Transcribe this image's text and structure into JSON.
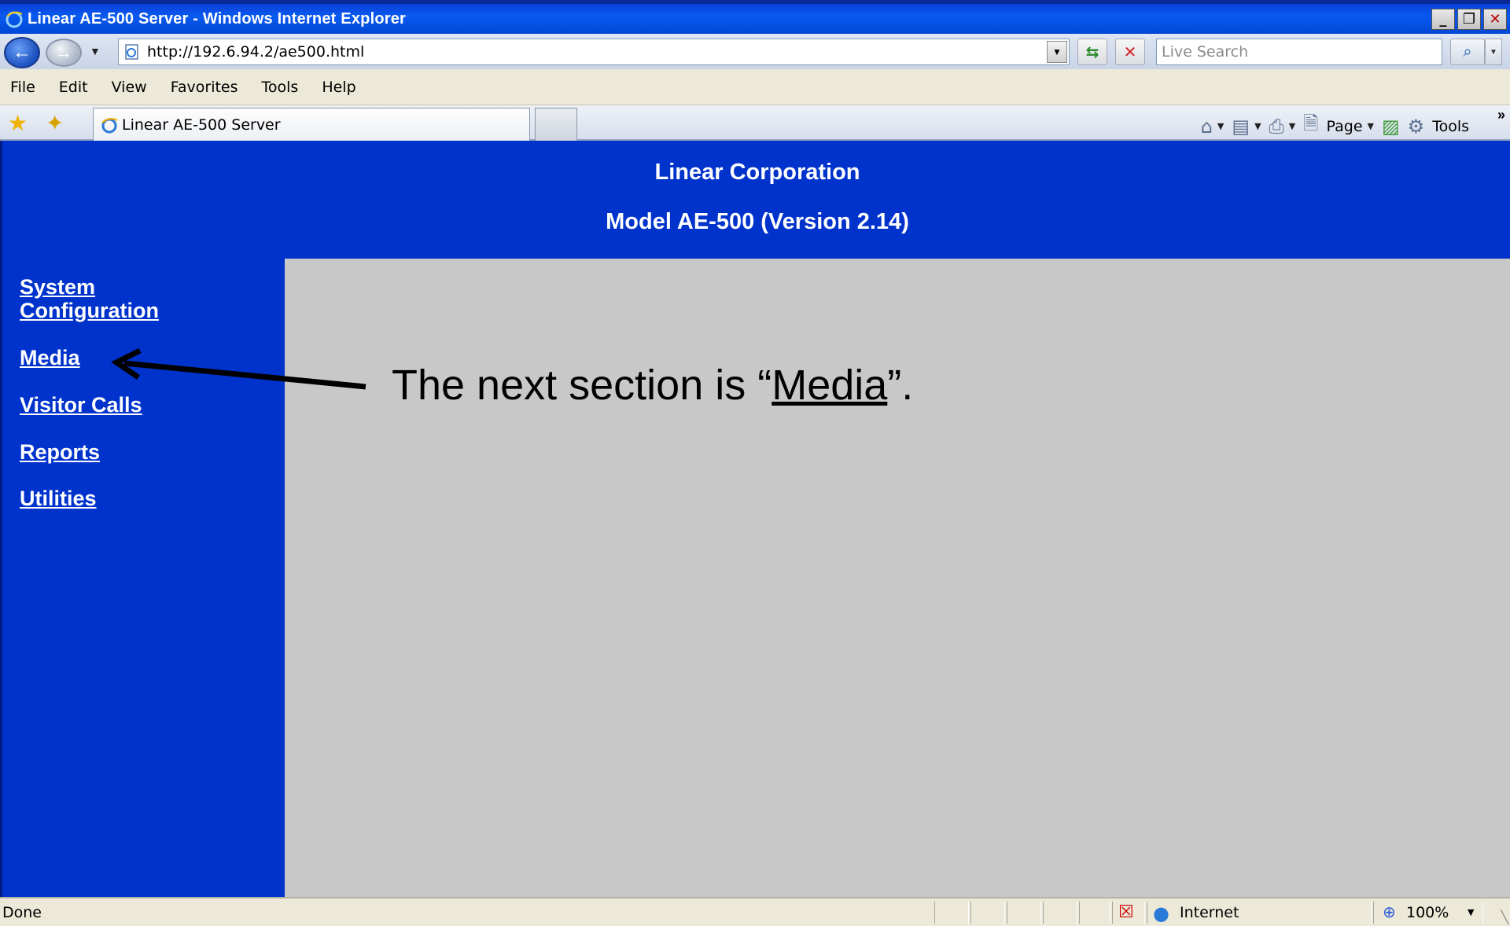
{
  "window": {
    "title": "Linear AE-500 Server - Windows Internet Explorer",
    "controls": [
      "_",
      "❐",
      "✕"
    ]
  },
  "address_bar": {
    "url": "http://192.6.94.2/ae500.html",
    "search_placeholder": "Live Search"
  },
  "menu": {
    "items": [
      "File",
      "Edit",
      "View",
      "Favorites",
      "Tools",
      "Help"
    ]
  },
  "tabs": {
    "active_label": "Linear AE-500 Server"
  },
  "command_bar": {
    "page_label": "Page",
    "tools_label": "Tools"
  },
  "page": {
    "company": "Linear Corporation",
    "model": "Model AE-500 (Version 2.14)",
    "nav": [
      {
        "label_line1": "System",
        "label_line2": "Configuration"
      },
      {
        "label": "Media"
      },
      {
        "label": "Visitor Calls"
      },
      {
        "label": "Reports"
      },
      {
        "label": "Utilities"
      }
    ]
  },
  "annotation": {
    "prefix": "The next section is “",
    "highlight": "Media",
    "suffix": "”."
  },
  "status_bar": {
    "status": "Done",
    "zone": "Internet",
    "zoom": "100%"
  },
  "colors": {
    "page_blue": "#0033cc",
    "content_gray": "#c8c8c8",
    "title_blue": "#0a5af0"
  }
}
